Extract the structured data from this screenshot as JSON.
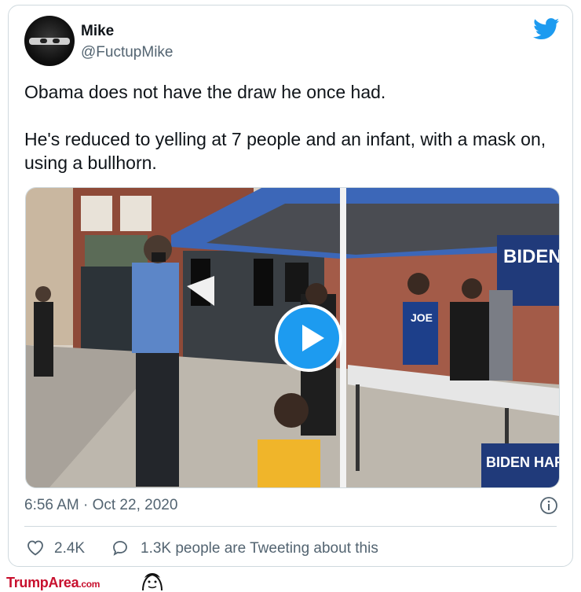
{
  "author": {
    "display_name": "Mike",
    "handle": "@FuctupMike"
  },
  "tweet": {
    "text": "Obama does not have the draw he once had.\n\nHe's reduced to yelling at 7 people and an infant, with a mask on, using a bullhorn.",
    "timestamp": "6:56 AM · Oct 22, 2020"
  },
  "media": {
    "type": "video",
    "signs": [
      "BIDEN HARRIS",
      "BIDEN HARRIS",
      "JOE"
    ]
  },
  "stats": {
    "likes": "2.4K",
    "tweeting": "1.3K people are Tweeting about this"
  },
  "watermark": {
    "brand": "TrumpArea",
    "suffix": ".com"
  },
  "icons": {
    "brand": "twitter-bird-icon",
    "play": "play-icon",
    "info": "info-icon",
    "like": "heart-icon",
    "reply": "speech-bubble-icon"
  },
  "colors": {
    "accent": "#1d9bf0",
    "text": "#0f1419",
    "muted": "#536471",
    "watermark": "#c8102e"
  }
}
